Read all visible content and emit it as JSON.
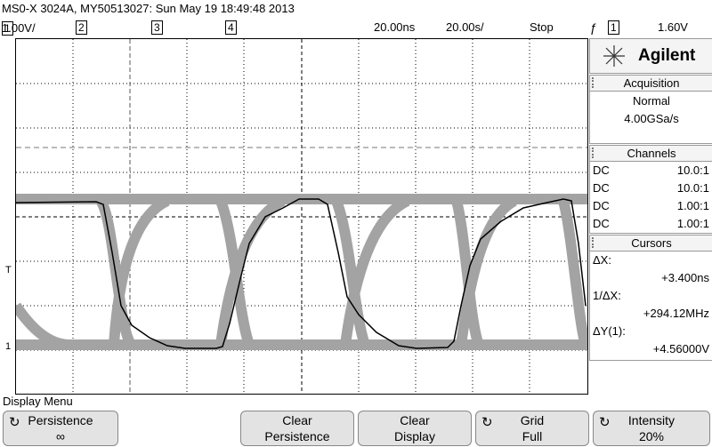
{
  "header": {
    "title": "MS0-X 3024A, MY50513027: Sun May 19 18:49:48 2013"
  },
  "status": {
    "ch1_num": "1",
    "ch1_scale": "1.00V/",
    "ch2_num": "2",
    "ch3_num": "3",
    "ch4_num": "4",
    "time_scale": "20.00ns",
    "time_delay": "20.00s/",
    "run_state": "Stop",
    "trigger_slope_icon": "rising-edge-icon",
    "trigger_source": "1",
    "trigger_level": "1.60V"
  },
  "brand": {
    "name": "Agilent"
  },
  "acquisition": {
    "header": "Acquisition",
    "mode": "Normal",
    "rate": "4.00GSa/s"
  },
  "channels": {
    "header": "Channels",
    "rows": [
      {
        "coupling": "DC",
        "probe": "10.0:1"
      },
      {
        "coupling": "DC",
        "probe": "10.0:1"
      },
      {
        "coupling": "DC",
        "probe": "1.00:1"
      },
      {
        "coupling": "DC",
        "probe": "1.00:1"
      }
    ]
  },
  "cursors": {
    "header": "Cursors",
    "dx_label": "ΔX:",
    "dx_value": "+3.400ns",
    "inv_dx_label": "1/ΔX:",
    "inv_dx_value": "+294.12MHz",
    "dy_label": "ΔY(1):",
    "dy_value": "+4.56000V"
  },
  "menu": {
    "title": "Display Menu",
    "keys": [
      {
        "line1": "Persistence",
        "line2": "∞"
      },
      {
        "line1": "Clear",
        "line2": "Persistence"
      },
      {
        "line1": "Clear",
        "line2": "Display"
      },
      {
        "line1": "Grid",
        "line2": "Full"
      },
      {
        "line1": "Intensity",
        "line2": "20%"
      }
    ]
  },
  "markers": {
    "trigger": "T",
    "ground": "1"
  },
  "colors": {
    "persistence": "#a3a3a3",
    "trace": "#000000",
    "grid": "#000000"
  }
}
